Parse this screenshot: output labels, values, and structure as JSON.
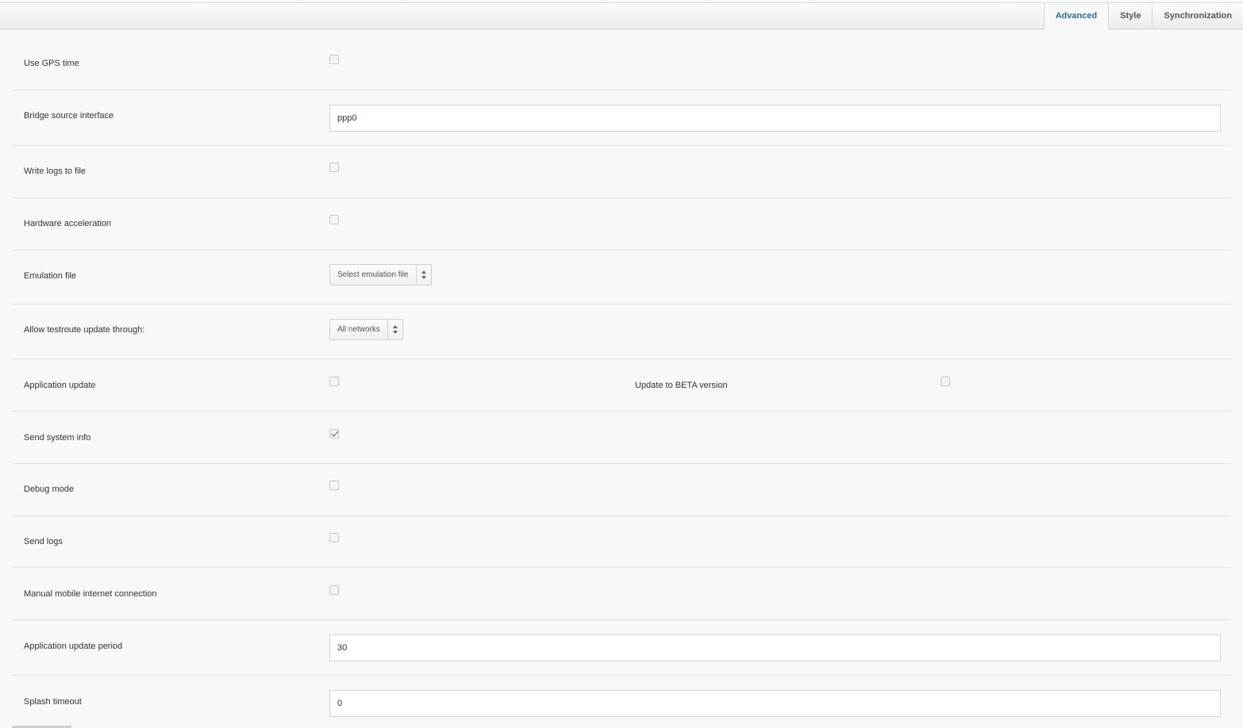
{
  "tabs": [
    {
      "label": "Advanced",
      "active": true
    },
    {
      "label": "Style",
      "active": false
    },
    {
      "label": "Synchronization",
      "active": false
    }
  ],
  "settings": {
    "use_gps_time": {
      "label": "Use GPS time",
      "checked": false
    },
    "bridge_source_interface": {
      "label": "Bridge source interface",
      "value": "ppp0"
    },
    "write_logs_to_file": {
      "label": "Write logs to file",
      "checked": false
    },
    "hardware_acceleration": {
      "label": "Hardware acceleration",
      "checked": false
    },
    "emulation_file": {
      "label": "Emulation file",
      "selected": "Select emulation file"
    },
    "allow_testroute_update": {
      "label": "Allow testroute update through:",
      "selected": "All networks"
    },
    "application_update": {
      "label": "Application update",
      "checked": false
    },
    "update_to_beta": {
      "label": "Update to BETA version",
      "checked": false
    },
    "send_system_info": {
      "label": "Send system info",
      "checked": true
    },
    "debug_mode": {
      "label": "Debug mode",
      "checked": false
    },
    "send_logs": {
      "label": "Send logs",
      "checked": false
    },
    "manual_mobile_internet": {
      "label": "Manual mobile internet connection",
      "checked": false
    },
    "application_update_period": {
      "label": "Application update period",
      "value": "30"
    },
    "splash_timeout": {
      "label": "Splash timeout",
      "value": "0"
    }
  },
  "colors": {
    "active_tab": "#2f6ea5",
    "background": "#f8f8f8",
    "divider": "#e2e2e2"
  }
}
